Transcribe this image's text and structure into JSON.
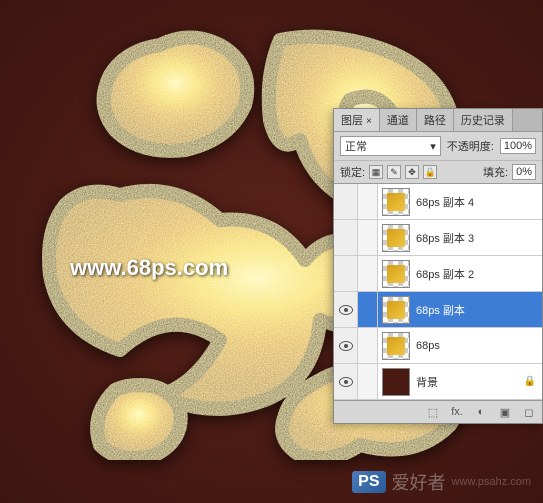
{
  "watermark": "www.68ps.com",
  "bottom_watermark": {
    "ps": "PS",
    "text": "爱好者",
    "url": "www.psahz.com"
  },
  "panel": {
    "tabs": [
      "图层",
      "通道",
      "路径",
      "历史记录"
    ],
    "active_tab": 0,
    "blend_mode": "正常",
    "opacity_label": "不透明度:",
    "opacity_value": "100%",
    "lock_label": "锁定:",
    "fill_label": "填充:",
    "fill_value": "0%",
    "layers": [
      {
        "name": "68ps 副本 4",
        "visible": false,
        "selected": false,
        "thumb": "gold"
      },
      {
        "name": "68ps 副本 3",
        "visible": false,
        "selected": false,
        "thumb": "gold"
      },
      {
        "name": "68ps 副本 2",
        "visible": false,
        "selected": false,
        "thumb": "gold"
      },
      {
        "name": "68ps 副本",
        "visible": true,
        "selected": true,
        "thumb": "gold"
      },
      {
        "name": "68ps",
        "visible": true,
        "selected": false,
        "thumb": "gold"
      },
      {
        "name": "背景",
        "visible": true,
        "selected": false,
        "thumb": "bg",
        "locked": true
      }
    ],
    "footer_icons": [
      "⬚",
      "fx.",
      "◐",
      "▣",
      "◻"
    ]
  }
}
